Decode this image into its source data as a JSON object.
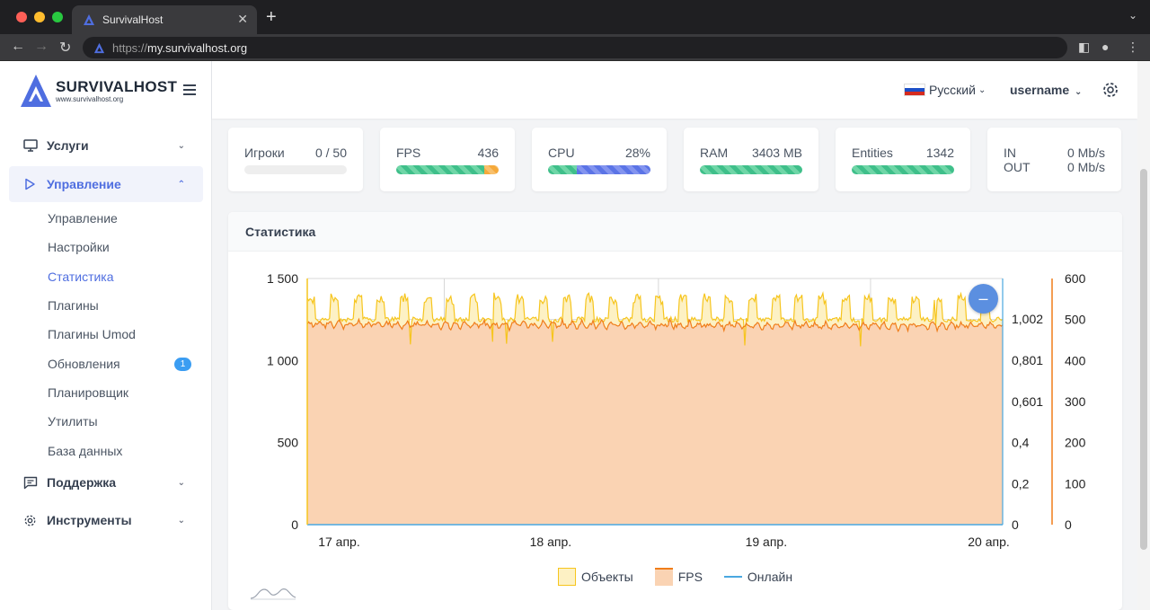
{
  "browser": {
    "tab_title": "SurvivalHost",
    "url_protocol": "https://",
    "url_host": "my.survivalhost.org"
  },
  "logo": {
    "name": "SURVIVALHOST",
    "url": "www.survivalhost.org"
  },
  "sidebar": {
    "items": [
      {
        "label": "Услуги",
        "icon": "monitor-icon"
      },
      {
        "label": "Управление",
        "icon": "play-icon",
        "active": true
      },
      {
        "label": "Поддержка",
        "icon": "chat-icon"
      },
      {
        "label": "Инструменты",
        "icon": "gear-icon"
      }
    ],
    "sub_items": [
      {
        "label": "Управление"
      },
      {
        "label": "Настройки"
      },
      {
        "label": "Статистика",
        "current": true
      },
      {
        "label": "Плагины"
      },
      {
        "label": "Плагины Umod"
      },
      {
        "label": "Обновления",
        "badge": "1"
      },
      {
        "label": "Планировщик"
      },
      {
        "label": "Утилиты"
      },
      {
        "label": "База данных"
      }
    ]
  },
  "header": {
    "language": "Русский",
    "username": "username"
  },
  "stats": {
    "players": {
      "label": "Игроки",
      "value": "0 / 50",
      "fill": 0
    },
    "fps": {
      "label": "FPS",
      "value": "436",
      "fill_green": 0.86,
      "fill_orange": 0.14
    },
    "cpu": {
      "label": "CPU",
      "value": "28%",
      "fill_green": 0.28,
      "fill_blue": 0.72
    },
    "ram": {
      "label": "RAM",
      "value": "3403 MB",
      "fill": 1
    },
    "entities": {
      "label": "Entities",
      "value": "1342",
      "fill": 1
    },
    "network": {
      "in_label": "IN",
      "in_value": "0 Mb/s",
      "out_label": "OUT",
      "out_value": "0 Mb/s"
    }
  },
  "panel": {
    "title": "Статистика"
  },
  "colors": {
    "accent": "#4f6ee0",
    "objects": "#f6c51e",
    "fps": "#f07d1a",
    "online": "#4aa8e0"
  },
  "chart_data": {
    "type": "area",
    "x_ticks": [
      "17 апр.",
      "18 апр.",
      "19 апр.",
      "20 апр."
    ],
    "y_left_ticks": [
      "1 500",
      "1 000",
      "500",
      "0"
    ],
    "y_mid_ticks": [
      "1,002",
      "0,801",
      "0,601",
      "0,4",
      "0,2",
      "0"
    ],
    "y_right_ticks": [
      "600",
      "500",
      "400",
      "300",
      "200",
      "100",
      "0"
    ],
    "y_left_range": [
      0,
      1500
    ],
    "y_right_range": [
      0,
      600
    ],
    "grid": true,
    "legend_position": "bottom",
    "series": [
      {
        "name": "Объекты",
        "axis": "left",
        "baseline": 1250,
        "peak": 1400,
        "period": 0.2
      },
      {
        "name": "FPS",
        "axis": "right",
        "baseline": 490,
        "range": [
          470,
          505
        ]
      },
      {
        "name": "Онлайн",
        "axis": "middle",
        "value": 0
      }
    ]
  }
}
